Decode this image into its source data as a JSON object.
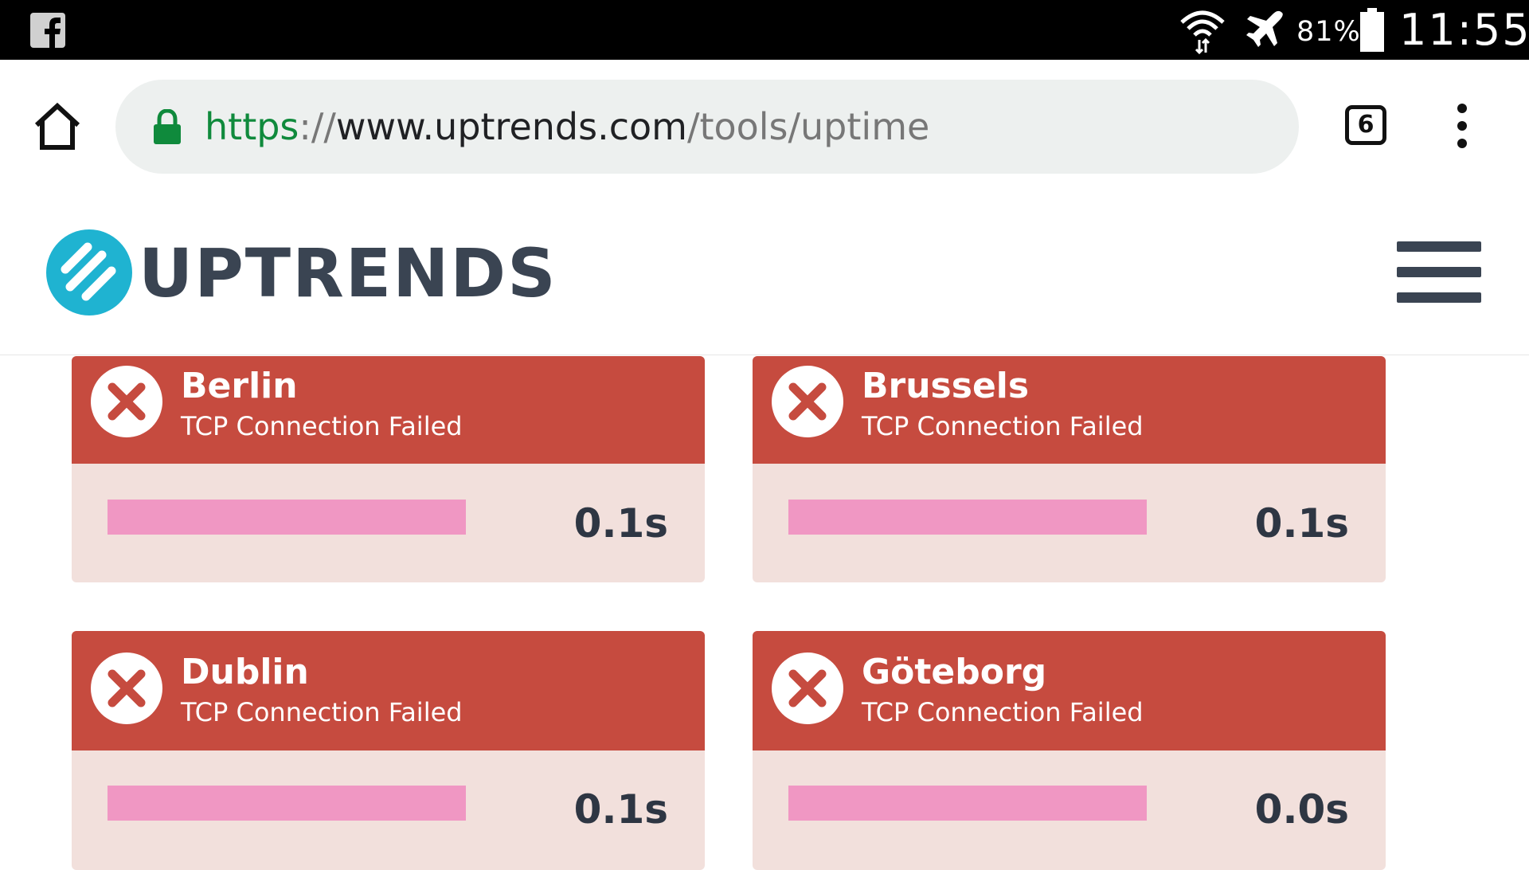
{
  "status_bar": {
    "app_icon": "facebook-icon",
    "battery_percent": "81%",
    "time": "11:55"
  },
  "browser": {
    "url_scheme": "https",
    "url_separator": "://",
    "url_host": "www.uptrends.com",
    "url_path": "/tools/uptime",
    "tab_count": "6"
  },
  "site": {
    "logo_text": "UPTRENDS"
  },
  "results": [
    {
      "city": "Berlin",
      "status": "TCP Connection Failed",
      "time": "0.1s"
    },
    {
      "city": "Brussels",
      "status": "TCP Connection Failed",
      "time": "0.1s"
    },
    {
      "city": "Dublin",
      "status": "TCP Connection Failed",
      "time": "0.1s"
    },
    {
      "city": "Göteborg",
      "status": "TCP Connection Failed",
      "time": "0.0s"
    }
  ],
  "colors": {
    "error_red": "#c64b3f",
    "card_bg": "#f2e0dc",
    "bar_pink": "#f097c3",
    "logo_teal": "#1fb3d1",
    "logo_text": "#3a4452",
    "secure_green": "#0f8a3c"
  }
}
